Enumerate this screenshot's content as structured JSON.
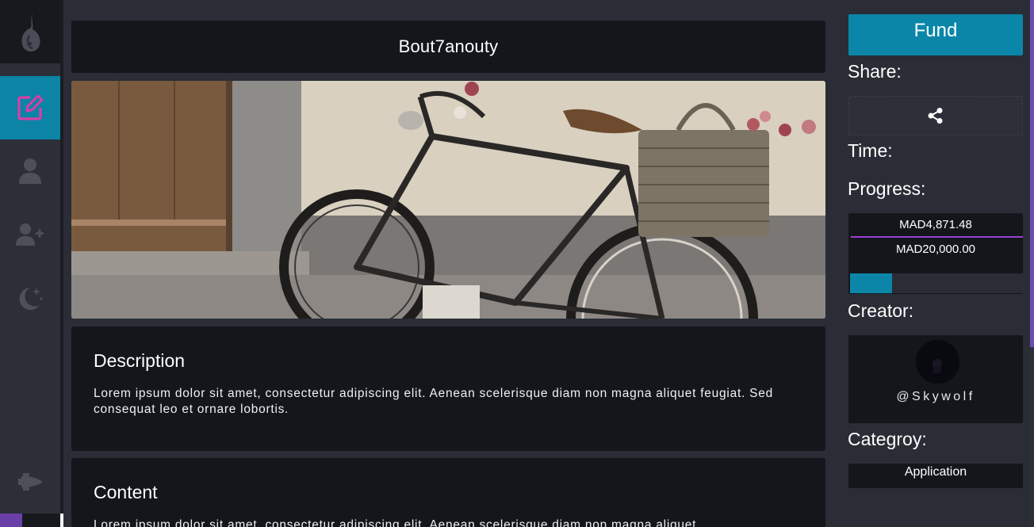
{
  "project": {
    "title": "Bout7anouty",
    "hero_alt": "Vintage bicycle with wicker basket leaning against a wall"
  },
  "sidebar": {
    "items": [
      {
        "name": "edit",
        "icon": "edit-icon",
        "active": true
      },
      {
        "name": "profile",
        "icon": "user-icon",
        "active": false
      },
      {
        "name": "add-user",
        "icon": "user-plus-icon",
        "active": false
      },
      {
        "name": "theme",
        "icon": "moon-stars-icon",
        "active": false
      },
      {
        "name": "launch",
        "icon": "space-shuttle-icon",
        "active": false
      }
    ]
  },
  "description": {
    "heading": "Description",
    "text": "Lorem ipsum dolor sit amet, consectetur adipiscing elit. Aenean scelerisque diam non magna aliquet feugiat. Sed consequat leo et ornare lobortis."
  },
  "content": {
    "heading": "Content",
    "text": "Lorem ipsum dolor sit amet, consectetur adipiscing elit. Aenean scelerisque diam non magna aliquet"
  },
  "sidebar_right": {
    "fund_label": "Fund",
    "share_label": "Share:",
    "time_label": "Time:",
    "progress_label": "Progress:",
    "creator_label": "Creator:",
    "category_label": "Categroy:",
    "share_icon": "share-icon"
  },
  "progress": {
    "raised": "MAD4,871.48",
    "goal": "MAD20,000.00",
    "fraction": 0.2436
  },
  "creator": {
    "handle": "@Skywolf"
  },
  "category": {
    "value": "Application"
  },
  "colors": {
    "accent": "#0b86a9",
    "active_nav": "#0b84a5",
    "progress_line": "#9b3fd6",
    "edit_icon": "#d93ea8",
    "card_bg": "#13171c",
    "page_bg": "#2a2d35"
  }
}
